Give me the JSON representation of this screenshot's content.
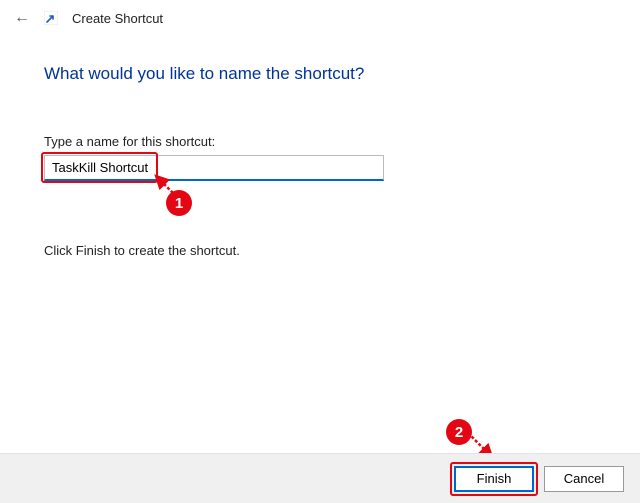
{
  "header": {
    "title": "Create Shortcut"
  },
  "main": {
    "heading": "What would you like to name the shortcut?",
    "field_label": "Type a name for this shortcut:",
    "input_value": "TaskKill Shortcut",
    "instruction": "Click Finish to create the shortcut."
  },
  "footer": {
    "finish_label": "Finish",
    "cancel_label": "Cancel"
  },
  "annotations": {
    "callout_1": "1",
    "callout_2": "2"
  }
}
